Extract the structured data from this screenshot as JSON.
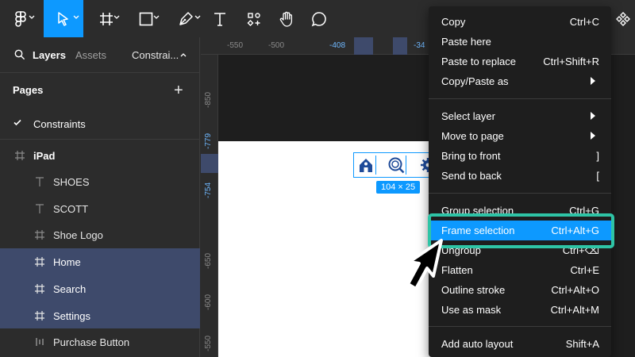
{
  "colors": {
    "accent": "#0d99ff",
    "panel": "#2c2c2c",
    "canvas": "#1e1e1e",
    "selection_row": "#3e4a6b",
    "highlight": "#2ec4a6"
  },
  "toolbar": {
    "tools": [
      {
        "name": "main-menu",
        "icon": "figma-logo-icon"
      },
      {
        "name": "move",
        "icon": "move-pointer-icon",
        "active": true
      },
      {
        "name": "frame",
        "icon": "frame-hash-icon"
      },
      {
        "name": "shape",
        "icon": "rectangle-icon"
      },
      {
        "name": "pen",
        "icon": "pen-icon"
      },
      {
        "name": "text",
        "icon": "text-t-icon"
      },
      {
        "name": "resources",
        "icon": "components-icon"
      },
      {
        "name": "hand",
        "icon": "hand-icon"
      },
      {
        "name": "comment",
        "icon": "comment-bubble-icon"
      }
    ]
  },
  "left_panel": {
    "tabs": {
      "layers": "Layers",
      "assets": "Assets",
      "page": "Constrai..."
    },
    "pages_title": "Pages",
    "current_page": "Constraints",
    "layers": [
      {
        "label": "iPad",
        "type": "frame",
        "icon": "frame-hash-icon"
      },
      {
        "label": "SHOES",
        "type": "text",
        "icon": "text-t-icon"
      },
      {
        "label": "SCOTT",
        "type": "text",
        "icon": "text-t-icon"
      },
      {
        "label": "Shoe Logo",
        "type": "frame",
        "icon": "frame-hash-icon"
      },
      {
        "label": "Home",
        "type": "frame",
        "icon": "frame-hash-icon",
        "selected": true
      },
      {
        "label": "Search",
        "type": "frame",
        "icon": "frame-hash-icon",
        "selected": true
      },
      {
        "label": "Settings",
        "type": "frame",
        "icon": "frame-hash-icon",
        "selected": true
      },
      {
        "label": "Purchase Button",
        "type": "auto-layout",
        "icon": "auto-layout-icon"
      }
    ]
  },
  "ruler_top": {
    "ticks": [
      "-550",
      "-500",
      "-408",
      "-34"
    ]
  },
  "ruler_left": {
    "ticks": [
      "-850",
      "-779",
      "-754",
      "-650",
      "-600",
      "-550"
    ]
  },
  "canvas": {
    "size_badge": "104 × 25"
  },
  "context_menu": {
    "items": [
      {
        "label": "Copy",
        "shortcut": "Ctrl+C"
      },
      {
        "label": "Paste here",
        "shortcut": ""
      },
      {
        "label": "Paste to replace",
        "shortcut": "Ctrl+Shift+R"
      },
      {
        "label": "Copy/Paste as",
        "shortcut": "",
        "submenu": true
      },
      {
        "label": "Select layer",
        "shortcut": "",
        "submenu": true
      },
      {
        "label": "Move to page",
        "shortcut": "",
        "submenu": true
      },
      {
        "label": "Bring to front",
        "shortcut": "]"
      },
      {
        "label": "Send to back",
        "shortcut": "["
      },
      {
        "label": "Group selection",
        "shortcut": "Ctrl+G"
      },
      {
        "label": "Frame selection",
        "shortcut": "Ctrl+Alt+G",
        "highlighted": true
      },
      {
        "label": "Ungroup",
        "shortcut": "Ctrl+⌫"
      },
      {
        "label": "Flatten",
        "shortcut": "Ctrl+E"
      },
      {
        "label": "Outline stroke",
        "shortcut": "Ctrl+Alt+O"
      },
      {
        "label": "Use as mask",
        "shortcut": "Ctrl+Alt+M"
      },
      {
        "label": "Add auto layout",
        "shortcut": "Shift+A"
      }
    ]
  }
}
